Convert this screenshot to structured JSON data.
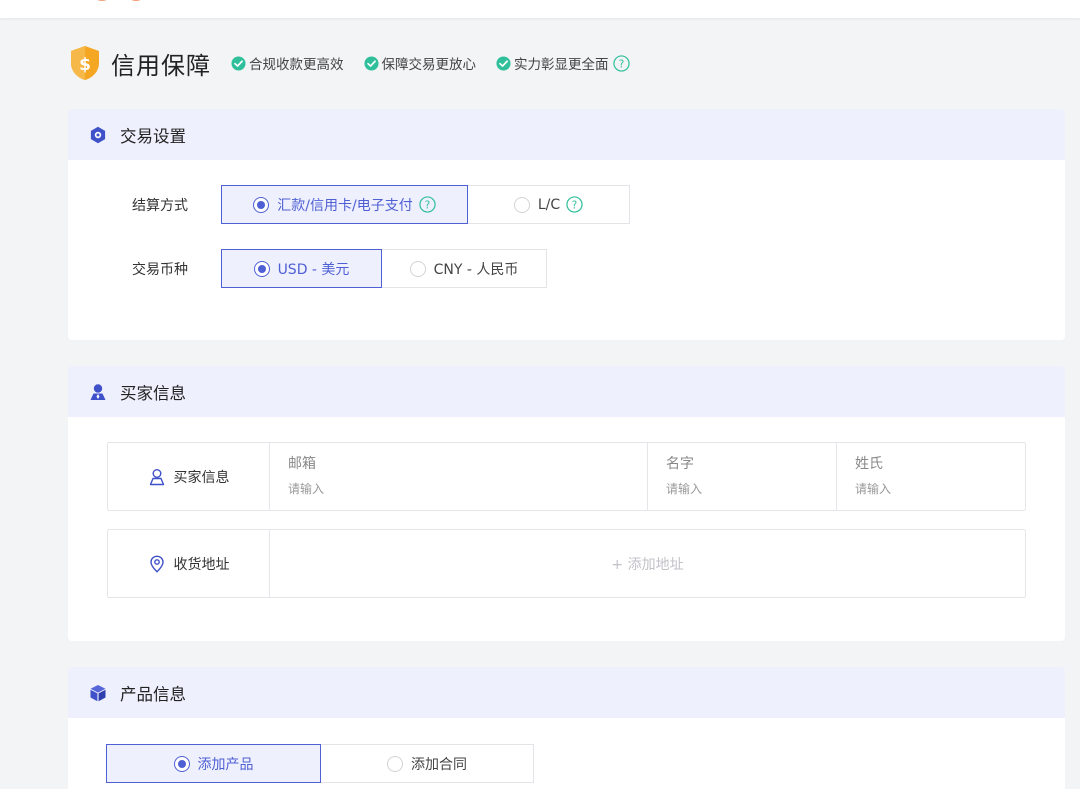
{
  "header": {
    "title": "信用保障",
    "features": [
      "合规收款更高效",
      "保障交易更放心",
      "实力彰显更全面"
    ]
  },
  "trade": {
    "title": "交易设置",
    "settlement_label": "结算方式",
    "settlement_options": [
      "汇款/信用卡/电子支付",
      "L/C"
    ],
    "currency_label": "交易币种",
    "currency_options": [
      "USD - 美元",
      "CNY - 人民币"
    ]
  },
  "buyer": {
    "title": "买家信息",
    "info_label": "买家信息",
    "fields": [
      {
        "label": "邮箱",
        "placeholder": "请输入"
      },
      {
        "label": "名字",
        "placeholder": "请输入"
      },
      {
        "label": "姓氏",
        "placeholder": "请输入"
      }
    ],
    "address_label": "收货地址",
    "add_address": "+ 添加地址"
  },
  "product": {
    "title": "产品信息",
    "options": [
      "添加产品",
      "添加合同"
    ]
  },
  "colors": {
    "accent": "#4f5fd4",
    "header_bg": "#eef0fd",
    "check_green": "#2fbf9a",
    "shield_orange": "#f5a623"
  }
}
